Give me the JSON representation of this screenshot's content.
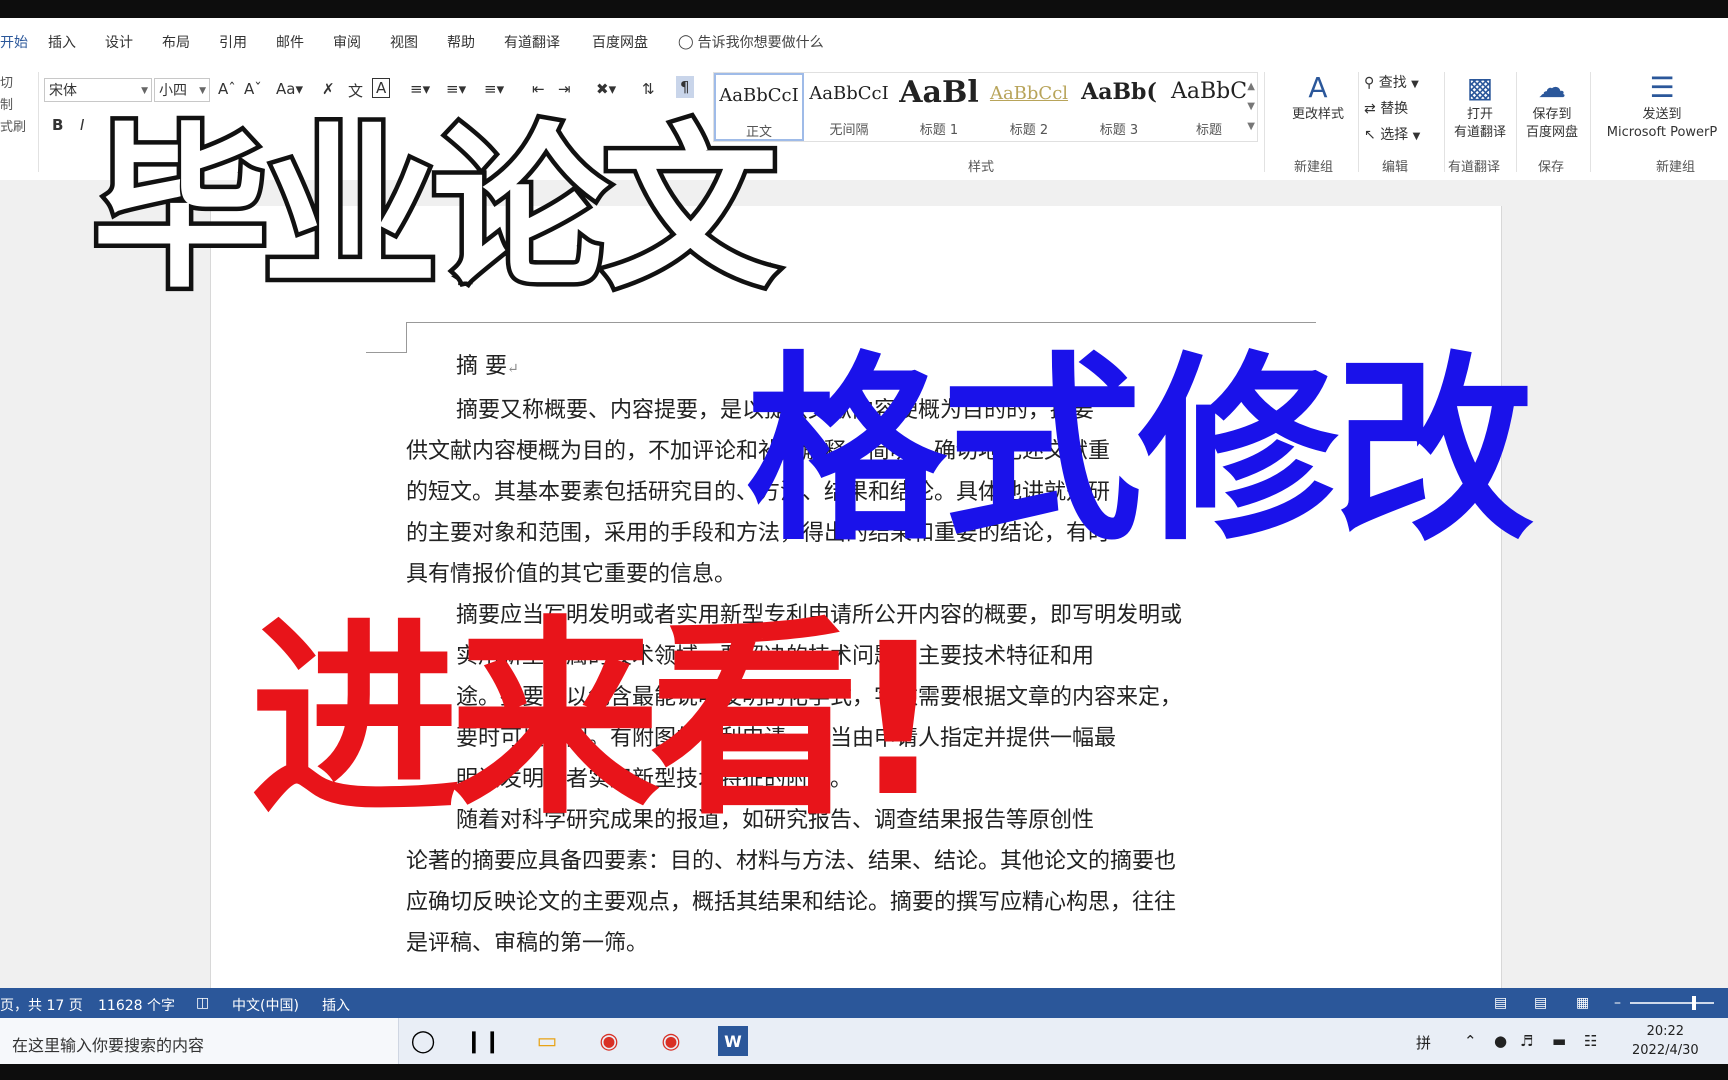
{
  "tabs": [
    {
      "label": "开始",
      "active": true
    },
    {
      "label": "插入"
    },
    {
      "label": "设计"
    },
    {
      "label": "布局"
    },
    {
      "label": "引用"
    },
    {
      "label": "邮件"
    },
    {
      "label": "审阅"
    },
    {
      "label": "视图"
    },
    {
      "label": "帮助"
    },
    {
      "label": "有道翻译"
    },
    {
      "label": "百度网盘"
    }
  ],
  "tell_me": "告诉我你想要做什么",
  "clipboard": {
    "cut": "切",
    "copy": "制",
    "format_painter": "式刷"
  },
  "font": {
    "name": "宋体",
    "size": "小四"
  },
  "styles": {
    "group_label": "样式",
    "items": [
      {
        "sample": "AaBbCcI",
        "name": "正文"
      },
      {
        "sample": "AaBbCcI",
        "name": "无间隔"
      },
      {
        "sample": "AaBl",
        "name": "标题 1"
      },
      {
        "sample": "AaBbCcl",
        "name": "标题 2"
      },
      {
        "sample": "AaBb(",
        "name": "标题 3"
      },
      {
        "sample": "AaBbC",
        "name": "标题"
      }
    ]
  },
  "ribbon_right": {
    "change_styles": "更改样式",
    "find": "查找",
    "replace": "替换",
    "select": "选择",
    "open_youdao_1": "打开",
    "open_youdao_2": "有道翻译",
    "save_baidu_1": "保存到",
    "save_baidu_2": "百度网盘",
    "send_1": "发送到",
    "send_2": "Microsoft PowerP",
    "grp_new": "新建组",
    "grp_edit": "编辑",
    "grp_youdao": "有道翻译",
    "grp_save": "保存",
    "grp_new2": "新建组"
  },
  "document": {
    "heading": "摘  要",
    "lines": [
      "摘要又称概要、内容提要，是以提供文献内容梗概为目的的，摘要",
      "供文献内容梗概为目的，不加评论和补充解释，简明、确切地记述文献重",
      "的短文。其基本要素包括研究目的、方法、结果和结论。具体地讲就是研",
      "的主要对象和范围，采用的手段和方法，得出的结果和重要的结论，有时",
      "具有情报价值的其它重要的信息。",
      "摘要应当写明发明或者实用新型专利申请所公开内容的概要，即写明发明或",
      "实用新型所属的技术领域、要解决的技术问题、主要技术特征和用",
      "途。摘要可以包含最能说明发明的化学式，字数需要根据文章的内容来定，",
      "要时可以附图。有附图的专利申请，应当由申请人指定并提供一幅最",
      "明该发明或者实用新型技术特征的附图。",
      "随着对科学研究成果的报道，如研究报告、调查结果报告等原创性",
      "论著的摘要应具备四要素：目的、材料与方法、结果、结论。其他论文的摘要也",
      "应确切反映论文的主要观点，概括其结果和结论。摘要的撰写应精心构思，往往",
      "是评稿、审稿的第一筛。"
    ]
  },
  "status": {
    "pages": "页，共 17 页",
    "words": "11628 个字",
    "lang": "中文(中国)",
    "mode": "插入"
  },
  "taskbar": {
    "search_placeholder": "在这里输入你要搜索的内容",
    "ime": "拼",
    "time": "20:22",
    "date": "2022/4/30"
  },
  "overlay": {
    "title1": "毕业论文",
    "title2": "格式修改",
    "title3": "进来看!"
  },
  "colors": {
    "ribbon_accent": "#2b579a",
    "overlay_blue": "#1a12ea",
    "overlay_red": "#e8141a"
  }
}
